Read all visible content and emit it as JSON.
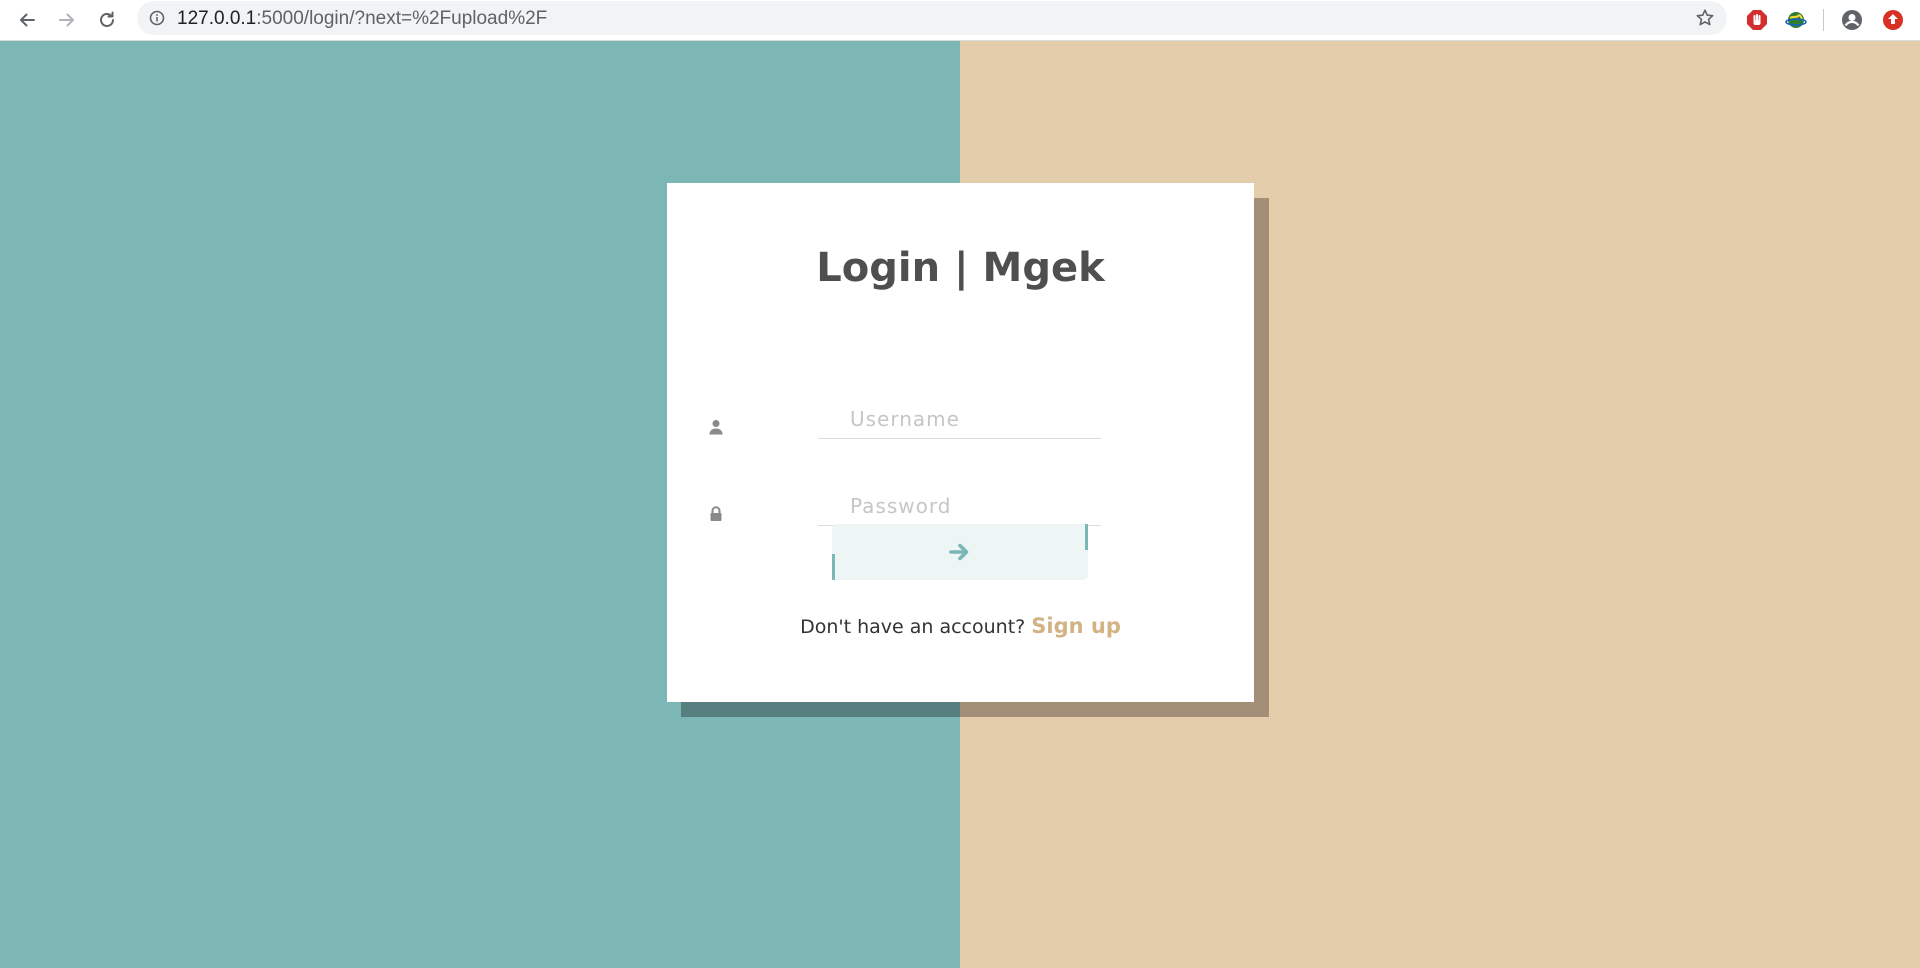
{
  "browser": {
    "url_host": "127.0.0.1",
    "url_path": ":5000/login/?next=%2Fupload%2F"
  },
  "icons": {
    "back": "arrow-left-icon",
    "forward": "arrow-right-icon",
    "reload": "reload-icon",
    "site_info": "info-circle-icon",
    "bookmark": "star-icon",
    "ext_adblock": "stop-hand-icon",
    "ext_globe": "globe-icon",
    "profile": "account-circle-icon",
    "update": "update-arrow-icon",
    "username_field": "user-icon",
    "password_field": "lock-icon",
    "submit": "arrow-right-icon"
  },
  "colors": {
    "left_bg": "#7cb6b5",
    "right_bg": "#e4cdaa",
    "title": "#4f4f4f",
    "accent": "#7cb6b5",
    "link": "#d1b384"
  },
  "login": {
    "title": "Login | Mgek",
    "username_placeholder": "Username",
    "password_placeholder": "Password",
    "no_account_text": "Don't have an account?",
    "signup_label": "Sign up"
  }
}
